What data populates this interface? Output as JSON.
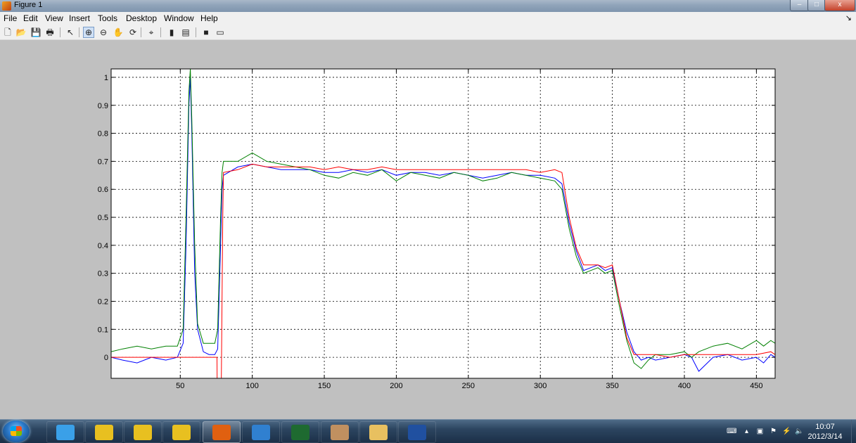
{
  "window": {
    "title": "Figure 1",
    "controls": {
      "minimize": "–",
      "maximize": "□",
      "close": "x"
    }
  },
  "menu": {
    "items": [
      "File",
      "Edit",
      "View",
      "Insert",
      "Tools",
      "Desktop",
      "Window",
      "Help"
    ],
    "dock_arrow": "↘"
  },
  "toolbar": {
    "tools": [
      {
        "name": "new-figure-icon",
        "glyph": "🗋"
      },
      {
        "name": "open-file-icon",
        "glyph": "📂"
      },
      {
        "name": "save-figure-icon",
        "glyph": "💾"
      },
      {
        "name": "print-figure-icon",
        "glyph": "🖶"
      },
      {
        "name": "edit-plot-icon",
        "glyph": "↖"
      },
      {
        "name": "zoom-in-icon",
        "glyph": "⊕",
        "active": true
      },
      {
        "name": "zoom-out-icon",
        "glyph": "⊖"
      },
      {
        "name": "pan-icon",
        "glyph": "✋"
      },
      {
        "name": "rotate-3d-icon",
        "glyph": "⟳"
      },
      {
        "name": "data-cursor-icon",
        "glyph": "⌖"
      },
      {
        "name": "insert-colorbar-icon",
        "glyph": "▮"
      },
      {
        "name": "insert-legend-icon",
        "glyph": "▤"
      },
      {
        "name": "hide-plot-tools-icon",
        "glyph": "■"
      },
      {
        "name": "show-plot-tools-icon",
        "glyph": "▭"
      }
    ]
  },
  "chart_data": {
    "type": "line",
    "title": "",
    "xlabel": "",
    "ylabel": "",
    "xlim": [
      2,
      463
    ],
    "ylim": [
      -0.075,
      1.03
    ],
    "xticks": [
      50,
      100,
      150,
      200,
      250,
      300,
      350,
      400,
      450
    ],
    "yticks": [
      0,
      0.1,
      0.2,
      0.3,
      0.4,
      0.5,
      0.6,
      0.7,
      0.8,
      0.9,
      1
    ],
    "grid": true,
    "grid_style": "dotted",
    "legend": "none",
    "series": [
      {
        "color": "#0000ff",
        "x": [
          2,
          10,
          20,
          30,
          40,
          48,
          52,
          54,
          56,
          57,
          58,
          60,
          62,
          66,
          70,
          74,
          76,
          78,
          79,
          80,
          90,
          100,
          110,
          120,
          130,
          140,
          150,
          160,
          170,
          180,
          190,
          200,
          210,
          220,
          230,
          240,
          250,
          260,
          270,
          280,
          290,
          300,
          310,
          315,
          320,
          325,
          330,
          335,
          340,
          345,
          350,
          355,
          360,
          365,
          370,
          375,
          380,
          390,
          400,
          405,
          410,
          420,
          430,
          440,
          450,
          455,
          460,
          463
        ],
        "y": [
          0.0,
          -0.01,
          -0.02,
          0.0,
          -0.01,
          0.0,
          0.05,
          0.4,
          0.9,
          1.0,
          0.8,
          0.3,
          0.1,
          0.02,
          0.01,
          0.01,
          0.03,
          0.4,
          0.6,
          0.65,
          0.68,
          0.69,
          0.68,
          0.67,
          0.67,
          0.67,
          0.66,
          0.66,
          0.67,
          0.66,
          0.67,
          0.65,
          0.66,
          0.66,
          0.65,
          0.66,
          0.65,
          0.64,
          0.65,
          0.66,
          0.65,
          0.65,
          0.64,
          0.62,
          0.48,
          0.38,
          0.31,
          0.32,
          0.33,
          0.31,
          0.32,
          0.2,
          0.09,
          0.02,
          -0.01,
          0.0,
          -0.01,
          0.0,
          0.01,
          0.0,
          -0.05,
          0.0,
          0.01,
          -0.01,
          0.0,
          -0.02,
          0.01,
          0.0
        ]
      },
      {
        "color": "#008000",
        "x": [
          2,
          10,
          20,
          30,
          40,
          48,
          52,
          54,
          56,
          57,
          58,
          60,
          62,
          66,
          70,
          74,
          76,
          78,
          79,
          80,
          90,
          100,
          110,
          120,
          130,
          140,
          150,
          160,
          170,
          180,
          190,
          200,
          210,
          220,
          230,
          240,
          250,
          260,
          270,
          280,
          290,
          300,
          310,
          315,
          320,
          325,
          330,
          335,
          340,
          345,
          350,
          355,
          360,
          365,
          370,
          375,
          380,
          390,
          400,
          405,
          410,
          420,
          430,
          440,
          450,
          455,
          460,
          463
        ],
        "y": [
          0.02,
          0.03,
          0.04,
          0.03,
          0.04,
          0.04,
          0.1,
          0.5,
          0.95,
          1.03,
          0.85,
          0.4,
          0.12,
          0.05,
          0.05,
          0.05,
          0.1,
          0.5,
          0.66,
          0.7,
          0.7,
          0.73,
          0.7,
          0.69,
          0.68,
          0.67,
          0.65,
          0.64,
          0.66,
          0.65,
          0.67,
          0.63,
          0.66,
          0.65,
          0.64,
          0.66,
          0.65,
          0.63,
          0.64,
          0.66,
          0.65,
          0.64,
          0.63,
          0.6,
          0.46,
          0.36,
          0.3,
          0.31,
          0.32,
          0.3,
          0.31,
          0.18,
          0.06,
          -0.02,
          -0.04,
          -0.01,
          0.01,
          0.01,
          0.02,
          0.0,
          0.02,
          0.04,
          0.05,
          0.03,
          0.06,
          0.04,
          0.06,
          0.05
        ]
      },
      {
        "color": "#ff0000",
        "x": [
          2,
          10,
          20,
          30,
          40,
          50,
          60,
          70,
          74,
          75.5,
          75.6,
          78.5,
          79.5,
          80,
          90,
          100,
          110,
          120,
          130,
          140,
          150,
          160,
          170,
          180,
          190,
          200,
          210,
          220,
          230,
          240,
          250,
          260,
          270,
          280,
          290,
          300,
          310,
          315,
          320,
          325,
          330,
          335,
          340,
          345,
          350,
          355,
          360,
          365,
          370,
          380,
          390,
          400,
          410,
          420,
          430,
          440,
          450,
          460,
          463
        ],
        "y": [
          0.0,
          0.0,
          0.0,
          0.0,
          0.0,
          0.0,
          0.0,
          0.0,
          0.0,
          0.0,
          -0.075,
          -0.075,
          0.5,
          0.66,
          0.67,
          0.69,
          0.68,
          0.68,
          0.68,
          0.68,
          0.67,
          0.68,
          0.67,
          0.67,
          0.68,
          0.67,
          0.67,
          0.67,
          0.67,
          0.67,
          0.67,
          0.67,
          0.67,
          0.67,
          0.67,
          0.66,
          0.67,
          0.66,
          0.5,
          0.39,
          0.33,
          0.33,
          0.33,
          0.32,
          0.33,
          0.2,
          0.07,
          0.01,
          0.01,
          0.01,
          0.0,
          0.01,
          0.01,
          0.01,
          0.01,
          0.01,
          0.01,
          0.02,
          0.01
        ]
      }
    ]
  },
  "taskbar": {
    "items": [
      {
        "name": "qq-icon",
        "type": "pinned",
        "color": "#3aa0e8"
      },
      {
        "name": "paint-app-icon-1",
        "type": "pinned",
        "color": "#e8c020"
      },
      {
        "name": "paint-app-icon-2",
        "type": "pinned",
        "color": "#e8c020"
      },
      {
        "name": "paint-app-icon-3",
        "type": "pinned",
        "color": "#e8c020"
      },
      {
        "name": "matlab-icon",
        "type": "running",
        "color": "#e06010"
      },
      {
        "name": "browser-icon",
        "type": "pinned",
        "color": "#3080d0"
      },
      {
        "name": "media-icon",
        "type": "pinned",
        "color": "#1e6a30"
      },
      {
        "name": "paint-palette-icon",
        "type": "pinned",
        "color": "#c09060"
      },
      {
        "name": "file-explorer-icon",
        "type": "pinned",
        "color": "#e8c060"
      },
      {
        "name": "word-icon",
        "type": "pinned",
        "color": "#2050a0"
      }
    ],
    "clock": {
      "time": "10:07",
      "date": "2012/3/14"
    },
    "tray": [
      "keyboard-icon",
      "show-hidden-icon",
      "network-icon",
      "action-center-icon",
      "power-icon",
      "volume-icon"
    ]
  }
}
